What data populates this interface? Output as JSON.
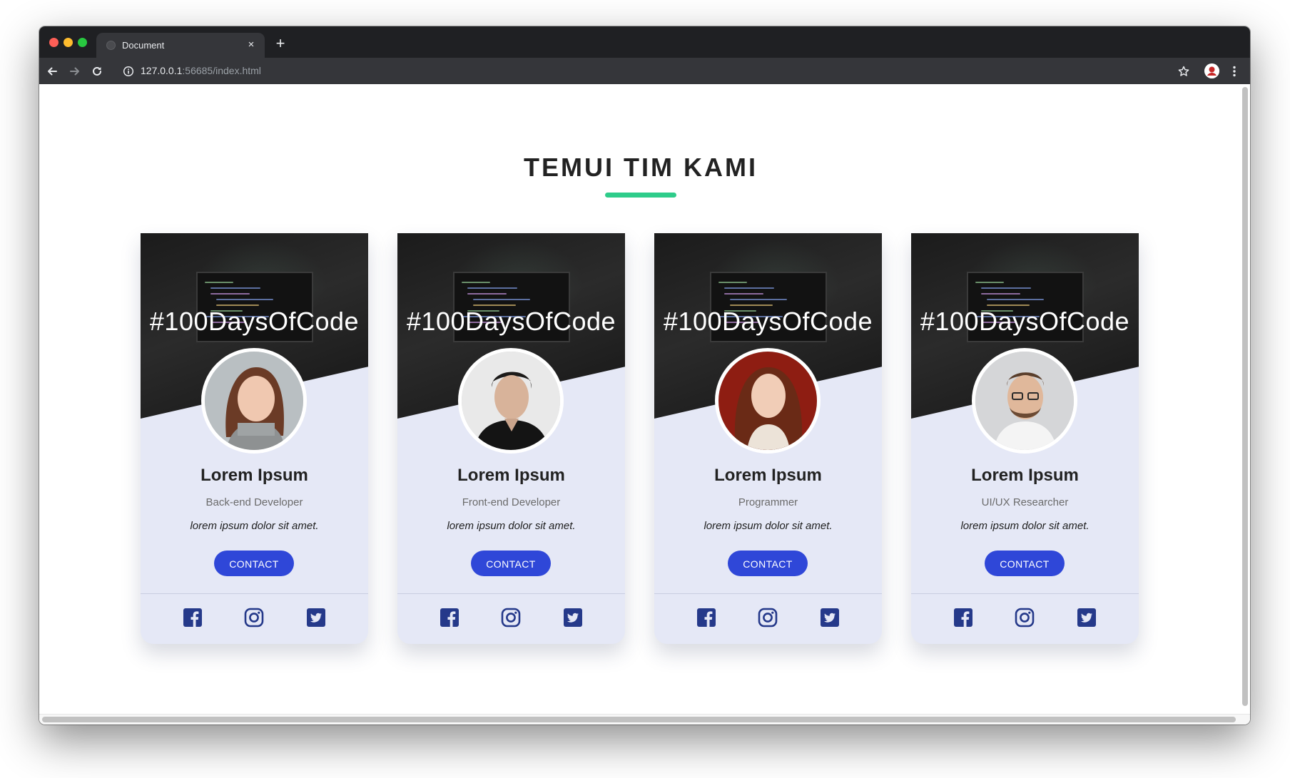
{
  "browser": {
    "tab_title": "Document",
    "tab_close": "×",
    "new_tab": "+",
    "url_host": "127.0.0.1",
    "url_rest": ":56685/index.html"
  },
  "page": {
    "heading": "TEMUI TIM KAMI",
    "accent_color": "#2ecc8a",
    "button_color": "#2f47d8",
    "cover_text": "#100DaysOfCode"
  },
  "members": [
    {
      "name": "Lorem Ipsum",
      "role": "Back-end Developer",
      "desc": "lorem ipsum dolor sit amet.",
      "button": "CONTACT",
      "photo_icon": "woman-portrait"
    },
    {
      "name": "Lorem Ipsum",
      "role": "Front-end Developer",
      "desc": "lorem ipsum dolor sit amet.",
      "button": "CONTACT",
      "photo_icon": "man-portrait"
    },
    {
      "name": "Lorem Ipsum",
      "role": "Programmer",
      "desc": "lorem ipsum dolor sit amet.",
      "button": "CONTACT",
      "photo_icon": "woman-portrait"
    },
    {
      "name": "Lorem Ipsum",
      "role": "UI/UX Researcher",
      "desc": "lorem ipsum dolor sit amet.",
      "button": "CONTACT",
      "photo_icon": "man-portrait"
    }
  ],
  "social_icons": [
    "facebook-icon",
    "instagram-icon",
    "twitter-icon"
  ]
}
